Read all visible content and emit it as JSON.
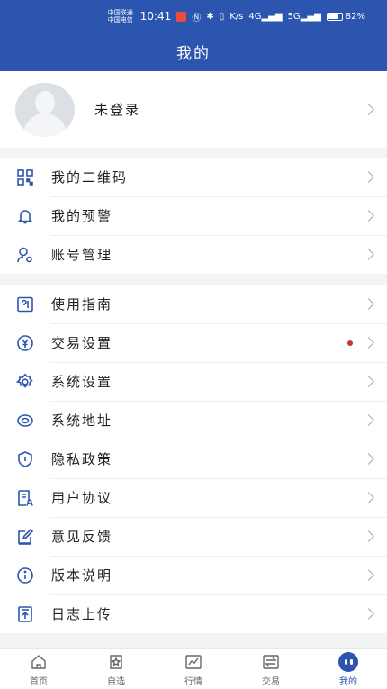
{
  "status_bar": {
    "carrier_top": "中国联通",
    "carrier_bottom": "中国电信",
    "time": "10:41",
    "network_a": "4G",
    "network_b": "5G",
    "speed": "K/s",
    "battery": "82%",
    "battery_level": 0.82
  },
  "header": {
    "title": "我的"
  },
  "profile": {
    "label": "未登录"
  },
  "group1": [
    {
      "icon": "qr-code-icon",
      "label": "我的二维码"
    },
    {
      "icon": "bell-icon",
      "label": "我的预警"
    },
    {
      "icon": "user-account-icon",
      "label": "账号管理"
    }
  ],
  "group2": [
    {
      "icon": "guide-icon",
      "label": "使用指南"
    },
    {
      "icon": "yen-icon",
      "label": "交易设置",
      "badge": true
    },
    {
      "icon": "gear-icon",
      "label": "系统设置"
    },
    {
      "icon": "eye-icon",
      "label": "系统地址"
    },
    {
      "icon": "shield-icon",
      "label": "隐私政策"
    },
    {
      "icon": "user-doc-icon",
      "label": "用户协议"
    },
    {
      "icon": "edit-icon",
      "label": "意见反馈"
    },
    {
      "icon": "info-icon",
      "label": "版本说明"
    },
    {
      "icon": "upload-icon",
      "label": "日志上传"
    }
  ],
  "tabbar": [
    {
      "icon": "home-icon",
      "label": "首页"
    },
    {
      "icon": "star-icon",
      "label": "自选"
    },
    {
      "icon": "chart-icon",
      "label": "行情"
    },
    {
      "icon": "trade-icon",
      "label": "交易"
    },
    {
      "icon": "mine-icon",
      "label": "我的",
      "active": true
    }
  ],
  "colors": {
    "primary": "#2c55b0",
    "badge": "#c0392b"
  }
}
